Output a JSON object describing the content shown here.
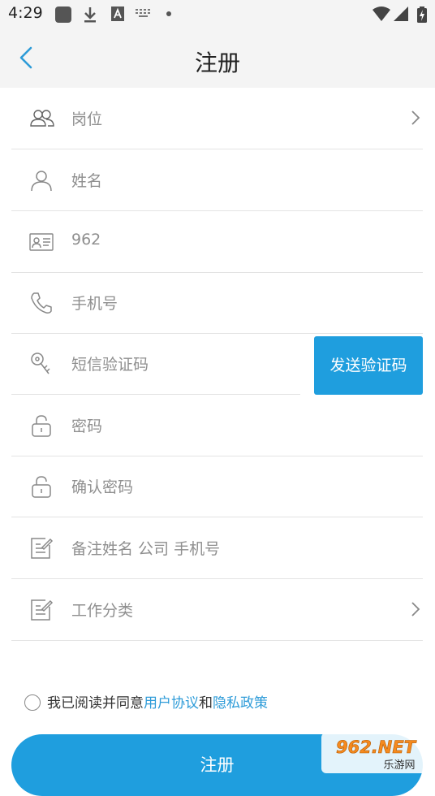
{
  "status_bar": {
    "time": "4:29",
    "icons": [
      "app-square-icon",
      "download-icon",
      "a-box-icon",
      "keyboard-icon",
      "dot-icon",
      "wifi-icon",
      "signal-icon",
      "battery-icon"
    ]
  },
  "header": {
    "back_icon": "chevron-left-icon",
    "title": "注册"
  },
  "form": {
    "rows": [
      {
        "icon": "users-icon",
        "label": "岗位",
        "has_chevron": true
      },
      {
        "icon": "user-icon",
        "label": "姓名",
        "has_chevron": false
      },
      {
        "icon": "id-card-icon",
        "label": "962",
        "has_chevron": false
      },
      {
        "icon": "phone-icon",
        "label": "手机号",
        "has_chevron": false
      },
      {
        "icon": "key-icon",
        "label": "短信验证码",
        "has_chevron": false
      },
      {
        "icon": "lock-icon",
        "label": "密码",
        "has_chevron": false
      },
      {
        "icon": "lock-icon",
        "label": "确认密码",
        "has_chevron": false
      },
      {
        "icon": "edit-note-icon",
        "label": "备注姓名 公司 手机号",
        "has_chevron": false
      },
      {
        "icon": "edit-note-icon",
        "label": "工作分类",
        "has_chevron": true
      }
    ],
    "send_code_label": "发送验证码"
  },
  "agreement": {
    "prefix": "我已阅读并同意",
    "user_agreement": "用户协议",
    "conjunction": "和",
    "privacy_policy": "隐私政策"
  },
  "register_label": "注册",
  "watermark": {
    "main": "962.NET",
    "sub": "乐游网"
  },
  "colors": {
    "accent": "#1f9ede",
    "link": "#2d9bd8",
    "header_bg": "#f4f4f4",
    "placeholder": "#8f8f8f",
    "divider": "#e3e3e3"
  }
}
